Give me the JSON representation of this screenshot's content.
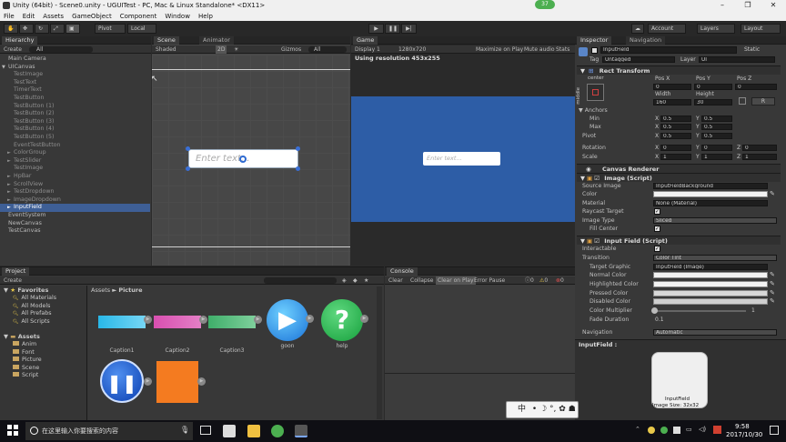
{
  "window": {
    "title": "Unity (64bit) - Scene0.unity - UGUITest - PC, Mac & Linux Standalone* <DX11>",
    "badge": "37"
  },
  "menu": [
    "File",
    "Edit",
    "Assets",
    "GameObject",
    "Component",
    "Window",
    "Help"
  ],
  "toolbar": {
    "pivot": "Pivot",
    "local": "Local",
    "account": "Account",
    "layers": "Layers",
    "layout": "Layout"
  },
  "hierarchy": {
    "tab": "Hierarchy",
    "create": "Create",
    "search": "All",
    "items": [
      {
        "label": "Main Camera",
        "indent": 0,
        "dim": false,
        "sel": false
      },
      {
        "label": "UICanvas",
        "indent": 0,
        "dim": false,
        "sel": false,
        "arrow": "▼"
      },
      {
        "label": "TestImage",
        "indent": 1,
        "dim": true,
        "sel": false
      },
      {
        "label": "TestText",
        "indent": 1,
        "dim": true,
        "sel": false
      },
      {
        "label": "TimerText",
        "indent": 1,
        "dim": true,
        "sel": false
      },
      {
        "label": "TestButton",
        "indent": 1,
        "dim": true,
        "sel": false
      },
      {
        "label": "TestButton (1)",
        "indent": 1,
        "dim": true,
        "sel": false
      },
      {
        "label": "TestButton (2)",
        "indent": 1,
        "dim": true,
        "sel": false
      },
      {
        "label": "TestButton (3)",
        "indent": 1,
        "dim": true,
        "sel": false
      },
      {
        "label": "TestButton (4)",
        "indent": 1,
        "dim": true,
        "sel": false
      },
      {
        "label": "TestButton (5)",
        "indent": 1,
        "dim": true,
        "sel": false
      },
      {
        "label": "EventTestButton",
        "indent": 1,
        "dim": true,
        "sel": false
      },
      {
        "label": "ColorGroup",
        "indent": 1,
        "dim": true,
        "sel": false,
        "arrow": "►"
      },
      {
        "label": "TestSlider",
        "indent": 1,
        "dim": true,
        "sel": false,
        "arrow": "►"
      },
      {
        "label": "TestImage",
        "indent": 1,
        "dim": true,
        "sel": false
      },
      {
        "label": "HpBar",
        "indent": 1,
        "dim": true,
        "sel": false,
        "arrow": "►"
      },
      {
        "label": "ScrollView",
        "indent": 1,
        "dim": true,
        "sel": false,
        "arrow": "►"
      },
      {
        "label": "TestDropdown",
        "indent": 1,
        "dim": true,
        "sel": false,
        "arrow": "►"
      },
      {
        "label": "ImageDropdown",
        "indent": 1,
        "dim": true,
        "sel": false,
        "arrow": "►"
      },
      {
        "label": "InputField",
        "indent": 1,
        "dim": false,
        "sel": true,
        "arrow": "►"
      },
      {
        "label": "EventSystem",
        "indent": 0,
        "dim": false,
        "sel": false
      },
      {
        "label": "NewCanvas",
        "indent": 0,
        "dim": false,
        "sel": false
      },
      {
        "label": "TestCanvas",
        "indent": 0,
        "dim": false,
        "sel": false
      }
    ]
  },
  "scene": {
    "tab": "Scene",
    "tab2": "Animator",
    "shaded": "Shaded",
    "mode": "2D",
    "gizmos": "Gizmos",
    "search": "All",
    "placeholder": "Enter text..."
  },
  "game": {
    "tab": "Game",
    "display": "Display 1",
    "resolution": "1280x720",
    "maximize": "Maximize on Play",
    "mute": "Mute audio",
    "stats": "Stats",
    "using": "Using resolution 453x255",
    "placeholder": "Enter text..."
  },
  "inspector": {
    "tab": "Inspector",
    "tab2": "Navigation",
    "name": "InputField",
    "static": "Static",
    "tag_label": "Tag",
    "tag": "Untagged",
    "layer_label": "Layer",
    "layer": "UI",
    "rect_title": "Rect Transform",
    "anchor_h": "center",
    "anchor_v": "middle",
    "pos_labels": [
      "Pos X",
      "Pos Y",
      "Pos Z"
    ],
    "pos_vals": [
      "0",
      "0",
      "0"
    ],
    "size_labels": [
      "Width",
      "Height"
    ],
    "size_vals": [
      "160",
      "30"
    ],
    "anchors": "Anchors",
    "min": "Min",
    "max": "Max",
    "pivot": "Pivot",
    "rotation": "Rotation",
    "scale": "Scale",
    "min_vals": [
      "0.5",
      "0.5"
    ],
    "max_vals": [
      "0.5",
      "0.5"
    ],
    "pivot_vals": [
      "0.5",
      "0.5"
    ],
    "rot_vals": [
      "0",
      "0",
      "0"
    ],
    "scale_vals": [
      "1",
      "1",
      "1"
    ],
    "xyz": [
      "X",
      "Y",
      "Z"
    ],
    "r_btn": "R",
    "canvas_renderer": "Canvas Renderer",
    "image_title": "Image (Script)",
    "source_image": "Source Image",
    "source_val": "InputFieldBackground",
    "color": "Color",
    "material": "Material",
    "material_val": "None (Material)",
    "raycast": "Raycast Target",
    "image_type": "Image Type",
    "image_type_val": "Sliced",
    "fill_center": "Fill Center",
    "input_title": "Input Field (Script)",
    "interactable": "Interactable",
    "transition": "Transition",
    "transition_val": "Color Tint",
    "target_graphic": "Target Graphic",
    "target_val": "InputField (Image)",
    "normal": "Normal Color",
    "highlighted": "Highlighted Color",
    "pressed": "Pressed Color",
    "disabled": "Disabled Color",
    "multiplier": "Color Multiplier",
    "multiplier_val": "1",
    "fade": "Fade Duration",
    "fade_val": "0.1",
    "navigation": "Navigation",
    "navigation_val": "Automatic",
    "preview_title": "InputField :",
    "preview_name": "InputField",
    "preview_size": "Image Size: 32x32"
  },
  "project": {
    "tab": "Project",
    "create": "Create",
    "favorites": "Favorites",
    "fav_items": [
      "All Materials",
      "All Models",
      "All Prefabs",
      "All Scripts"
    ],
    "assets": "Assets",
    "asset_folders": [
      "Anim",
      "Font",
      "Picture",
      "Scene",
      "Script"
    ],
    "crumb1": "Assets",
    "crumb_sep": "►",
    "crumb2": "Picture",
    "items": [
      {
        "label": "Caption1"
      },
      {
        "label": "Caption2"
      },
      {
        "label": "Caption3"
      },
      {
        "label": "goon"
      },
      {
        "label": "help"
      },
      {
        "label": ""
      },
      {
        "label": ""
      }
    ]
  },
  "console": {
    "tab": "Console",
    "clear": "Clear",
    "collapse": "Collapse",
    "clear_on_play": "Clear on Play",
    "error_pause": "Error Pause",
    "c1": "0",
    "c2": "0",
    "c3": "0"
  },
  "ime": {
    "text": "中"
  },
  "taskbar": {
    "search": "在这里输入你要搜索的内容",
    "time": "9:58",
    "date": "2017/10/30"
  },
  "colors": {
    "game_bg": "#2d5da6",
    "accent": "#3e5f96"
  }
}
